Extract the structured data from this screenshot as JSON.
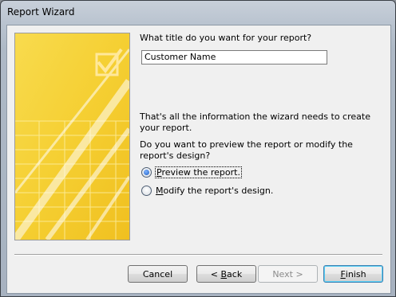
{
  "window": {
    "title": "Report Wizard"
  },
  "form": {
    "prompt": "What title do you want for your report?",
    "title_value": "Customer Name",
    "info_text": "That's all the information the wizard needs to create your report.",
    "question": "Do you want to preview the report or modify the report's design?",
    "options": [
      {
        "mnemonic": "P",
        "rest": "review the report.",
        "selected": true
      },
      {
        "mnemonic": "M",
        "rest": "odify the report's design.",
        "selected": false
      }
    ]
  },
  "buttons": {
    "cancel": "Cancel",
    "back_prefix": "< ",
    "back_mnemonic": "B",
    "back_rest": "ack",
    "next": "Next >",
    "finish_mnemonic": "F",
    "finish_rest": "inish"
  },
  "colors": {
    "art_yellow": "#f6d33c",
    "accent_blue": "#1f5fc4"
  }
}
